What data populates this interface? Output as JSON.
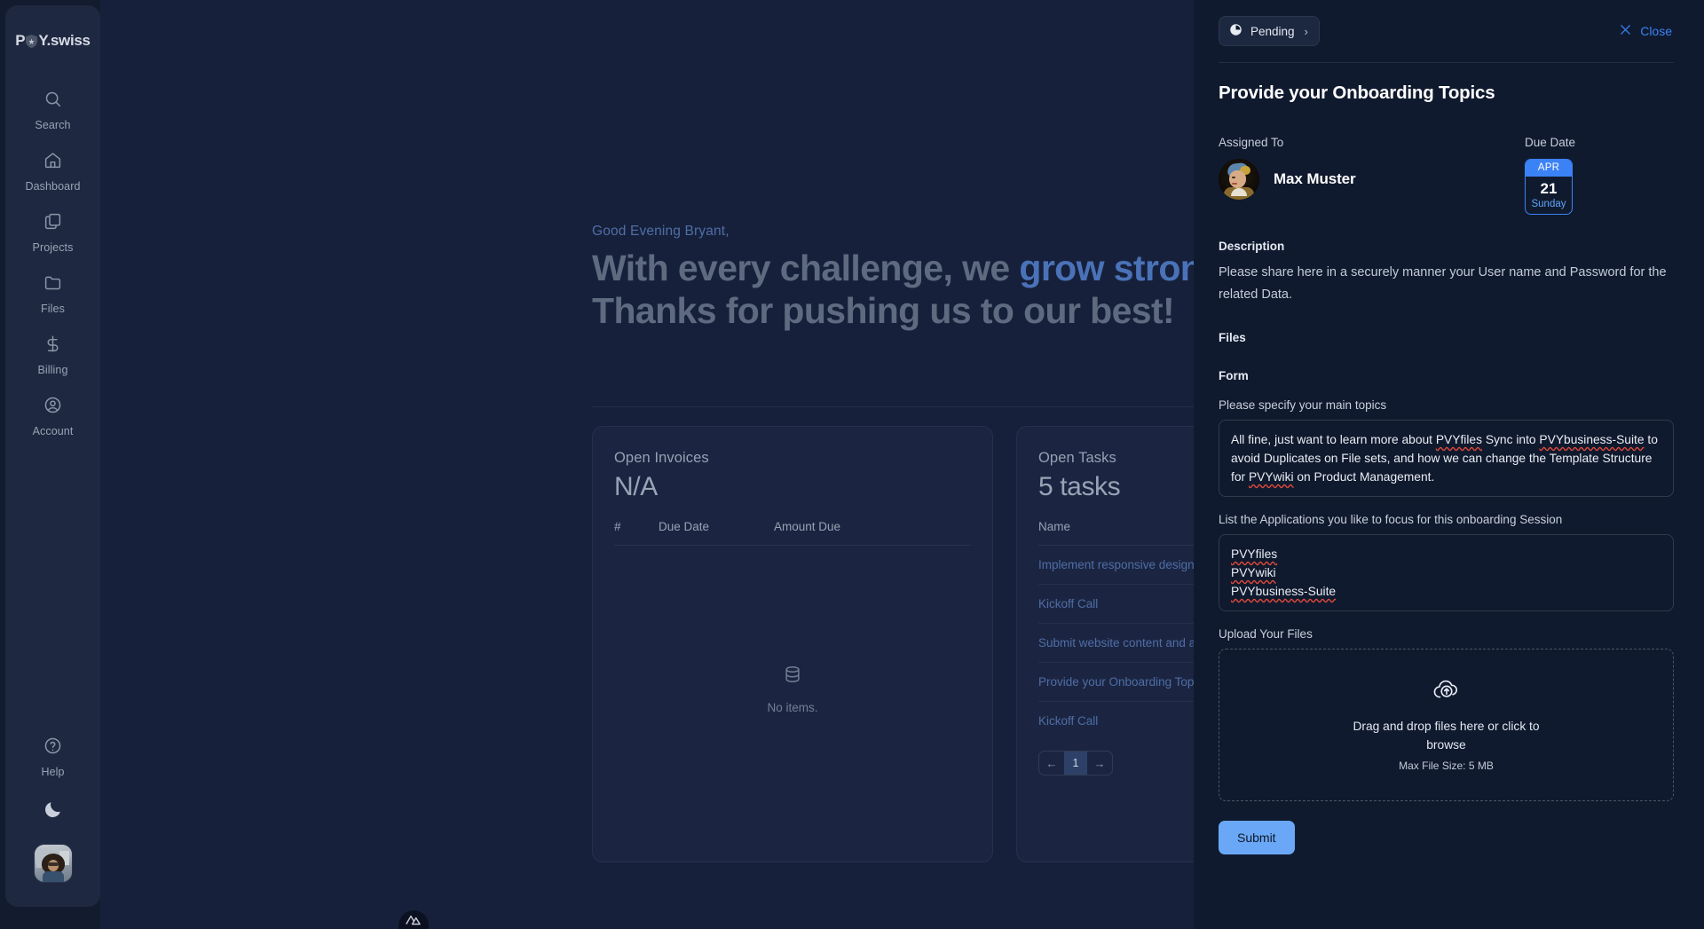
{
  "sidebar": {
    "logo": {
      "prefix": "P",
      "icon": "shield-icon",
      "suffix": "Y.swiss"
    },
    "items": [
      {
        "label": "Search",
        "icon": "search-icon"
      },
      {
        "label": "Dashboard",
        "icon": "home-icon"
      },
      {
        "label": "Projects",
        "icon": "copy-icon"
      },
      {
        "label": "Files",
        "icon": "folder-icon"
      },
      {
        "label": "Billing",
        "icon": "dollar-icon"
      },
      {
        "label": "Account",
        "icon": "user-circle-icon"
      }
    ],
    "help": {
      "label": "Help",
      "icon": "question-circle-icon"
    },
    "theme_toggle_icon": "moon-icon",
    "avatar_alt": "user-avatar"
  },
  "main": {
    "greeting": "Good Evening Bryant,",
    "headline_part1": "With every challenge, we ",
    "headline_accent1": "grow stronger",
    "headline_part2": ". Thanks for pushing us to our best!",
    "invoices": {
      "title": "Open Invoices",
      "value": "N/A",
      "columns": [
        "#",
        "Due Date",
        "Amount Due"
      ],
      "empty_text": "No items.",
      "empty_icon": "database-icon"
    },
    "tasks": {
      "title": "Open Tasks",
      "value": "5 tasks",
      "columns": [
        "Name"
      ],
      "rows": [
        "Implement responsive design for m...",
        "Kickoff Call",
        "Submit website content and assets",
        "Provide your Onboarding Topics",
        "Kickoff Call"
      ],
      "pagination": {
        "prev": "←",
        "page": "1",
        "next": "→"
      }
    }
  },
  "panel": {
    "status": {
      "label": "Pending",
      "icon": "clock-icon",
      "chevron": "›"
    },
    "close": {
      "label": "Close",
      "icon": "close-icon"
    },
    "title": "Provide your Onboarding Topics",
    "assigned_to": {
      "label": "Assigned To",
      "name": "Max Muster"
    },
    "due_date": {
      "label": "Due Date",
      "month": "APR",
      "day": "21",
      "weekday": "Sunday"
    },
    "description": {
      "label": "Description",
      "text": "Please share here in a securely manner your User name and Password for the related Data."
    },
    "files_label": "Files",
    "form_label": "Form",
    "fields": [
      {
        "label": "Please specify your main topics",
        "value": "All fine, just want to learn more about PVYfiles Sync into PVYbusiness-Suite to avoid Duplicates on File sets, and how we can change the Template Structure for PVYwiki on Product Management."
      },
      {
        "label": "List the Applications you like to focus for this onboarding Session",
        "value": "PVYfiles\nPVYwiki\nPVYbusiness-Suite"
      }
    ],
    "upload": {
      "label": "Upload Your Files",
      "icon": "cloud-upload-icon",
      "main_text": "Drag and drop files here or click to browse",
      "sub_text": "Max File Size: 5 MB"
    },
    "submit_label": "Submit"
  },
  "colors": {
    "accent_blue": "#3b82f6",
    "submit_blue": "#6aa8f7",
    "panel_bg": "#101a2e",
    "main_bg": "#17203a",
    "sidebar_bg": "#1e2840",
    "card_bg": "#1b2541",
    "headline_muted": "#5d6a80",
    "headline_accent": "#4a72b8"
  }
}
